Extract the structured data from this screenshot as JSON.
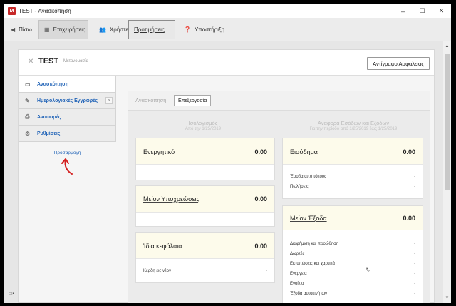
{
  "window": {
    "app_icon": "M",
    "title": "TEST - Ανασκόπηση",
    "controls": [
      "–",
      "☐",
      "✕"
    ]
  },
  "nav": {
    "back": "Πίσω",
    "businesses": "Επιχειρήσεις",
    "users": "Χρήστες",
    "preferences": "Προτιμήσεις",
    "help": "Υποστήριξη"
  },
  "business": {
    "name": "TEST",
    "rename": "Μετονομασία",
    "backup_button": "Αντίγραφο Ασφαλείας"
  },
  "sidebar": {
    "items": [
      {
        "label": "Ανασκόπηση",
        "icon": "monitor-icon"
      },
      {
        "label": "Ημερολογιακές Εγγραφές",
        "icon": "pencil-icon"
      },
      {
        "label": "Αναφορές",
        "icon": "printer-icon"
      },
      {
        "label": "Ρυθμίσεις",
        "icon": "gears-icon"
      }
    ],
    "customize": "Προσαρμογή"
  },
  "tabs": {
    "overview": "Ανασκόπηση",
    "edit": "Επεξεργασία"
  },
  "balance_sheet": {
    "title": "Ισολογισμός",
    "subtitle": "Από την 1/25/2019",
    "cards": [
      {
        "title": "Ενεργητικό",
        "value": "0.00",
        "rows": []
      },
      {
        "title": "Μείον Υποχρεώσεις",
        "value": "0.00",
        "rows": []
      },
      {
        "title": "Ίδια κεφάλαια",
        "value": "0.00",
        "rows": [
          {
            "label": "Κέρδη εις νέον",
            "value": "-"
          }
        ]
      }
    ]
  },
  "income_statement": {
    "title": "Αναφορά Εσόδων και Εξόδων",
    "subtitle": "Για την περίοδο από 1/25/2019 έως 1/25/2019",
    "income": {
      "title": "Εισόδημα",
      "value": "0.00",
      "rows": [
        {
          "label": "Έσοδα από τόκους",
          "value": "-"
        },
        {
          "label": "Πωλήσεις",
          "value": "-"
        }
      ]
    },
    "expenses": {
      "title": "Μείον Έξοδα",
      "value": "0.00",
      "rows": [
        {
          "label": "Διαφήμιση και προώθηση",
          "value": "-"
        },
        {
          "label": "Δωρεές",
          "value": "-"
        },
        {
          "label": "Εκτυπώσεις και χαρτικά",
          "value": "-"
        },
        {
          "label": "Ενέργεια",
          "value": "-"
        },
        {
          "label": "Ενοίκιο",
          "value": "-"
        },
        {
          "label": "Έξοδα αυτοκινήτων",
          "value": "-"
        }
      ]
    }
  },
  "colors": {
    "link_blue": "#2566b8",
    "card_header": "#fdfbeb",
    "annotation_red": "#d32020"
  }
}
